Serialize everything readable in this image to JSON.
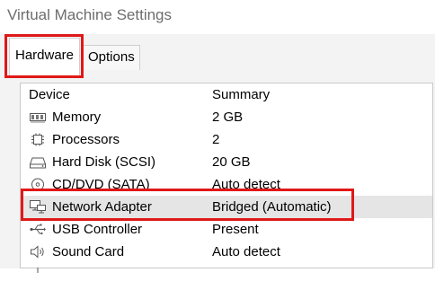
{
  "window": {
    "title": "Virtual Machine Settings"
  },
  "tabs": [
    {
      "label": "Hardware",
      "selected": true
    },
    {
      "label": "Options",
      "selected": false
    }
  ],
  "table": {
    "headers": {
      "device": "Device",
      "summary": "Summary"
    },
    "rows": [
      {
        "icon": "memory-icon",
        "device": "Memory",
        "summary": "2 GB"
      },
      {
        "icon": "processor-icon",
        "device": "Processors",
        "summary": "2"
      },
      {
        "icon": "hard-disk-icon",
        "device": "Hard Disk (SCSI)",
        "summary": "20 GB"
      },
      {
        "icon": "cd-dvd-icon",
        "device": "CD/DVD (SATA)",
        "summary": "Auto detect"
      },
      {
        "icon": "network-adapter-icon",
        "device": "Network Adapter",
        "summary": "Bridged (Automatic)",
        "selected": true
      },
      {
        "icon": "usb-controller-icon",
        "device": "USB Controller",
        "summary": "Present"
      },
      {
        "icon": "sound-card-icon",
        "device": "Sound Card",
        "summary": "Auto detect"
      }
    ]
  },
  "highlight_color": "#e01818"
}
